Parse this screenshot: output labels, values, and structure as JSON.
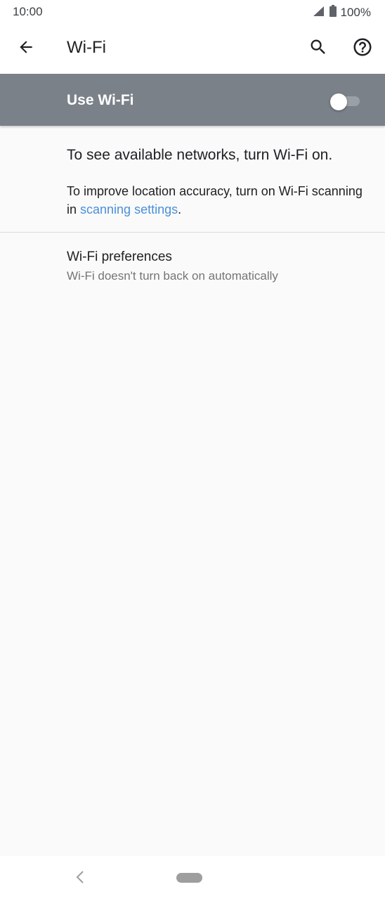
{
  "status_bar": {
    "time": "10:00",
    "battery_percent": "100%",
    "icons": [
      "signal-icon",
      "battery-icon"
    ]
  },
  "app_bar": {
    "title": "Wi-Fi",
    "icons": [
      "back-arrow-icon",
      "search-icon",
      "help-icon"
    ]
  },
  "master_switch": {
    "label": "Use Wi-Fi",
    "enabled": false
  },
  "content": {
    "off_message": "To see available networks, turn Wi-Fi on.",
    "hint_prefix": "To improve location accuracy, turn on Wi-Fi scanning in ",
    "hint_link": "scanning settings",
    "hint_suffix": "."
  },
  "preferences": {
    "title": "Wi-Fi preferences",
    "summary": "Wi-Fi doesn't turn back on automatically"
  },
  "colors": {
    "switch_bar_bg": "#7b8189",
    "link": "#4a8fd9",
    "background": "#fafafa"
  }
}
